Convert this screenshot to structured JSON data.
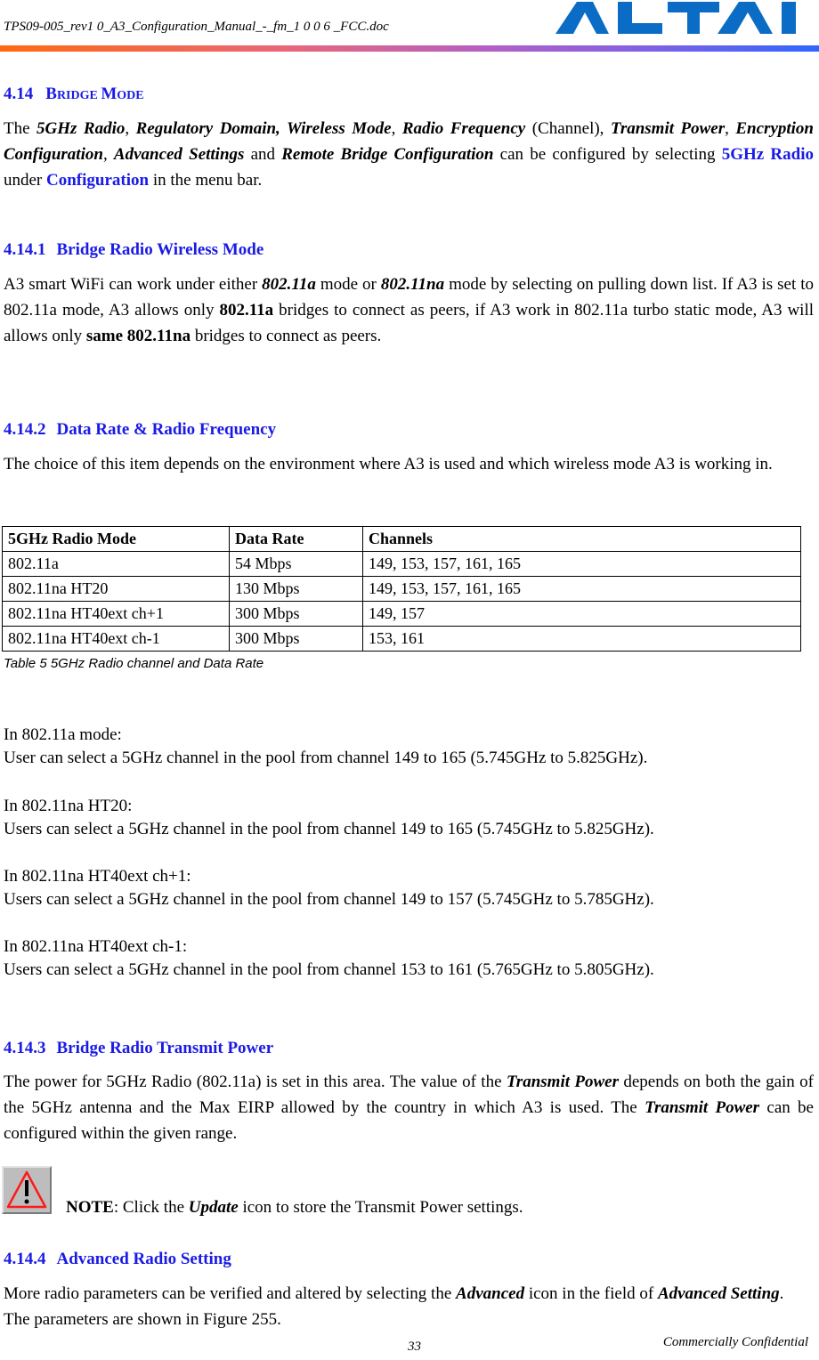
{
  "header": {
    "filename": "TPS09-005_rev1 0_A3_Configuration_Manual_-_fm_1 0 0 6 _FCC.doc",
    "logo_text": "ALTAI",
    "logo_color": "#0a6cc4"
  },
  "section": {
    "number": "4.14",
    "title_parts": [
      {
        "text": "B",
        "size": "big"
      },
      {
        "text": "RIDGE ",
        "size": "small"
      },
      {
        "text": "M",
        "size": "big"
      },
      {
        "text": "ODE",
        "size": "small"
      }
    ],
    "intro": {
      "t1": "The ",
      "b1": "5GHz Radio",
      "t2": ", ",
      "b2": "Regulatory Domain, Wireless Mode",
      "t3": ", ",
      "b3": "Radio Frequency",
      "t4": " (Channel), ",
      "b4": "Transmit Power",
      "t5": ", ",
      "b5": "Encryption Configuration",
      "t6": ", ",
      "b6": "Advanced Settings",
      "t7": " and ",
      "b7": "Remote Bridge Configuration",
      "t8": " can be configured by selecting ",
      "link1": "5GHz Radio",
      "t9": " under ",
      "link2": "Configuration",
      "t10": " in the menu bar."
    }
  },
  "sub1": {
    "number": "4.14.1",
    "title": "Bridge Radio Wireless Mode",
    "p": {
      "t1": "A3 smart WiFi can work under either ",
      "i1": "802.11a",
      "t2": " mode or ",
      "i2": "802.11na",
      "t3": " mode by selecting on pulling down list. If A3 is set to 802.11a mode, A3 allows only ",
      "b1": "802.11a",
      "t4": " bridges to connect as peers, if A3 work in 802.11a turbo static mode, A3 will allows only ",
      "b2": "same 802.11na",
      "t5": " bridges to connect as peers."
    }
  },
  "sub2": {
    "number": "4.14.2",
    "title": "Data Rate & Radio Frequency",
    "p": "The choice of this item depends on the environment where A3 is used and which wireless mode A3 is working in.",
    "table": {
      "headers": [
        "5GHz Radio Mode",
        "Data Rate",
        "Channels"
      ],
      "rows": [
        [
          "802.11a",
          "54 Mbps",
          "149, 153, 157, 161, 165"
        ],
        [
          "802.11na HT20",
          "130 Mbps",
          "149, 153, 157, 161, 165"
        ],
        [
          "802.11na HT40ext ch+1",
          "300 Mbps",
          "149, 157"
        ],
        [
          "802.11na HT40ext ch-1",
          "300 Mbps",
          "153, 161"
        ]
      ],
      "caption": "Table 5 5GHz Radio channel and Data Rate"
    },
    "modes": [
      {
        "label": "In 802.11a mode:",
        "desc": "User can select a 5GHz channel in the pool from channel 149 to 165 (5.745GHz to 5.825GHz)."
      },
      {
        "label": "In 802.11na HT20:",
        "desc": "Users can select a 5GHz channel in the pool from channel 149 to 165 (5.745GHz to 5.825GHz)."
      },
      {
        "label": "In 802.11na HT40ext ch+1:",
        "desc": "Users can select a 5GHz channel in the pool from channel 149 to 157 (5.745GHz to 5.785GHz)."
      },
      {
        "label": "In 802.11na HT40ext ch-1:",
        "desc": "Users can select a 5GHz channel in the pool from channel 153 to 161 (5.765GHz to 5.805GHz)."
      }
    ]
  },
  "sub3": {
    "number": "4.14.3",
    "title": "Bridge Radio Transmit Power",
    "p": {
      "t1": "The power for 5GHz Radio (802.11a) is set in this area. The value of the ",
      "b1": "Transmit Power",
      "t2": " depends on both the gain of the 5GHz antenna and the Max EIRP allowed by the country in which A3 is used. The ",
      "b2": "Transmit Power",
      "t3": " can be configured within the given range."
    },
    "note": {
      "label": "NOTE",
      "t1": ": Click the ",
      "i1": "Update",
      "t2": " icon to store the Transmit Power settings."
    }
  },
  "sub4": {
    "number": "4.14.4",
    "title": "Advanced Radio Setting",
    "p": {
      "t1": "More radio parameters can be verified and altered by selecting the ",
      "b1": "Advanced",
      "t2": " icon in the field of ",
      "b2": "Advanced Setting",
      "t3": ". The parameters are shown in Figure 255."
    }
  },
  "footer": {
    "page_number": "33",
    "confidential": "Commercially Confidential"
  }
}
